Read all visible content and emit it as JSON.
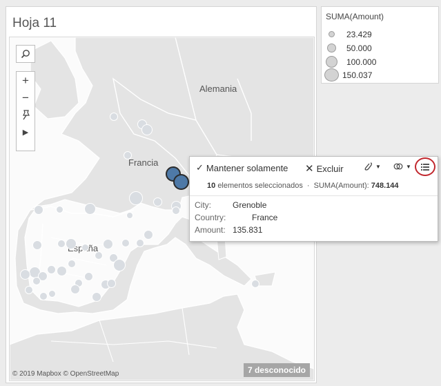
{
  "sheet": {
    "title": "Hoja 11"
  },
  "map": {
    "labels": {
      "germany": "Alemania",
      "france": "Francia",
      "spain": "España"
    },
    "attribution": "© 2019 Mapbox © OpenStreetMap",
    "unknown_badge": "7 desconocido",
    "colors": {
      "selected_fill": "#4e79a7",
      "unselected_fill": "#d9dde2",
      "land": "#e6e6e6",
      "water": "#fbfbfb"
    }
  },
  "tools": {
    "search_icon": "magnifier-icon",
    "zoom_in": "+",
    "zoom_out": "−",
    "pin_icon": "pin-icon",
    "expand_icon": "▶"
  },
  "legend": {
    "title": "SUMA(Amount)",
    "items": [
      {
        "label": "23.429"
      },
      {
        "label": "50.000"
      },
      {
        "label": "100.000"
      },
      {
        "label": "150.037"
      }
    ]
  },
  "tooltip": {
    "keep_only": "Mantener solamente",
    "exclude": "Excluir",
    "count": "10",
    "count_suffix": "elementos seleccionados",
    "separator": "·",
    "sum_label": "SUMA(Amount):",
    "sum_value": "748.144",
    "fields": [
      {
        "name": "City:",
        "value": "Grenoble"
      },
      {
        "name": "Country:",
        "value": "France"
      },
      {
        "name": "Amount:",
        "value": "135.831"
      }
    ]
  }
}
